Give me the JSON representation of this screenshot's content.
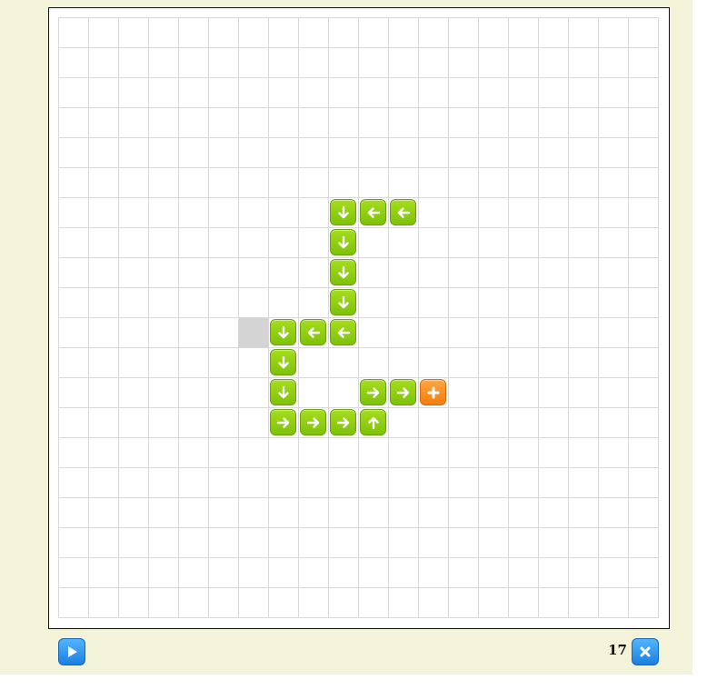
{
  "game": {
    "grid_cols": 20,
    "grid_rows": 20,
    "snake": [
      {
        "col": 9,
        "row": 6,
        "dir": "down"
      },
      {
        "col": 10,
        "row": 6,
        "dir": "left"
      },
      {
        "col": 11,
        "row": 6,
        "dir": "left"
      },
      {
        "col": 9,
        "row": 7,
        "dir": "down"
      },
      {
        "col": 9,
        "row": 8,
        "dir": "down"
      },
      {
        "col": 9,
        "row": 9,
        "dir": "down"
      },
      {
        "col": 7,
        "row": 10,
        "dir": "down"
      },
      {
        "col": 8,
        "row": 10,
        "dir": "left"
      },
      {
        "col": 9,
        "row": 10,
        "dir": "left"
      },
      {
        "col": 7,
        "row": 11,
        "dir": "down"
      },
      {
        "col": 7,
        "row": 12,
        "dir": "down"
      },
      {
        "col": 10,
        "row": 12,
        "dir": "right"
      },
      {
        "col": 11,
        "row": 12,
        "dir": "right"
      },
      {
        "col": 7,
        "row": 13,
        "dir": "right"
      },
      {
        "col": 8,
        "row": 13,
        "dir": "right"
      },
      {
        "col": 9,
        "row": 13,
        "dir": "right"
      },
      {
        "col": 10,
        "row": 13,
        "dir": "up"
      }
    ],
    "food": {
      "col": 12,
      "row": 12,
      "icon": "plus-icon"
    },
    "empty_cell": {
      "col": 6,
      "row": 10
    }
  },
  "controls": {
    "play_icon": "play-icon",
    "close_icon": "close-icon",
    "score": "17"
  },
  "colors": {
    "panel_bg": "#f3f3da",
    "snake_green": "#8ccd12",
    "food_orange": "#f7851b",
    "button_blue": "#2d92ee"
  }
}
